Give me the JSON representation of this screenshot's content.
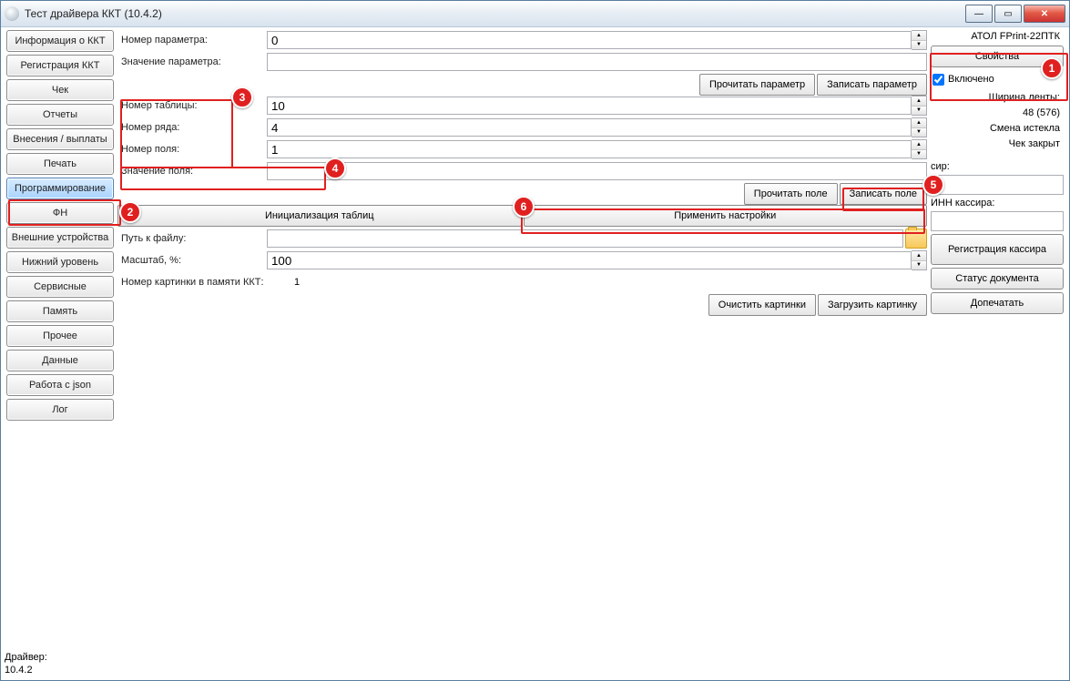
{
  "titlebar": {
    "title": "Тест драйвера ККТ (10.4.2)"
  },
  "sidebar": {
    "items": [
      "Информация о ККТ",
      "Регистрация ККТ",
      "Чек",
      "Отчеты",
      "Внесения / выплаты",
      "Печать",
      "Программирование",
      "ФН",
      "Внешние устройства",
      "Нижний уровень",
      "Сервисные",
      "Память",
      "Прочее",
      "Данные",
      "Работа с json",
      "Лог"
    ],
    "active_index": 6
  },
  "main": {
    "param_no_label": "Номер параметра:",
    "param_no_value": "0",
    "param_val_label": "Значение параметра:",
    "param_val_value": "",
    "read_param": "Прочитать параметр",
    "write_param": "Записать параметр",
    "table_no_label": "Номер таблицы:",
    "table_no_value": "10",
    "row_no_label": "Номер ряда:",
    "row_no_value": "4",
    "field_no_label": "Номер поля:",
    "field_no_value": "1",
    "field_val_label": "Значение поля:",
    "field_val_value": "",
    "read_field": "Прочитать поле",
    "write_field": "Записать поле",
    "init_tables": "Инициализация таблиц",
    "apply_settings": "Применить настройки",
    "file_path_label": "Путь к файлу:",
    "file_path_value": "",
    "scale_label": "Масштаб, %:",
    "scale_value": "100",
    "pic_no_label": "Номер картинки в памяти ККТ:",
    "pic_no_value": "1",
    "clear_pics": "Очистить картинки",
    "load_pic": "Загрузить картинку"
  },
  "right": {
    "device": "АТОЛ FPrint-22ПТК",
    "properties": "Свойства",
    "enabled_label": "Включено",
    "tape_width_label": "Ширина ленты:",
    "tape_width_value": "48 (576)",
    "shift_status": "Смена истекла",
    "cheque_status": "Чек закрыт",
    "cashier_partial": "сир:",
    "inn_label": "ИНН кассира:",
    "reg_cashier": "Регистрация кассира",
    "doc_status": "Статус документа",
    "reprint": "Допечатать",
    "driver_label": "Драйвер:",
    "driver_ver": "10.4.2"
  },
  "callouts": {
    "1": "1",
    "2": "2",
    "3": "3",
    "4": "4",
    "5": "5",
    "6": "6"
  }
}
